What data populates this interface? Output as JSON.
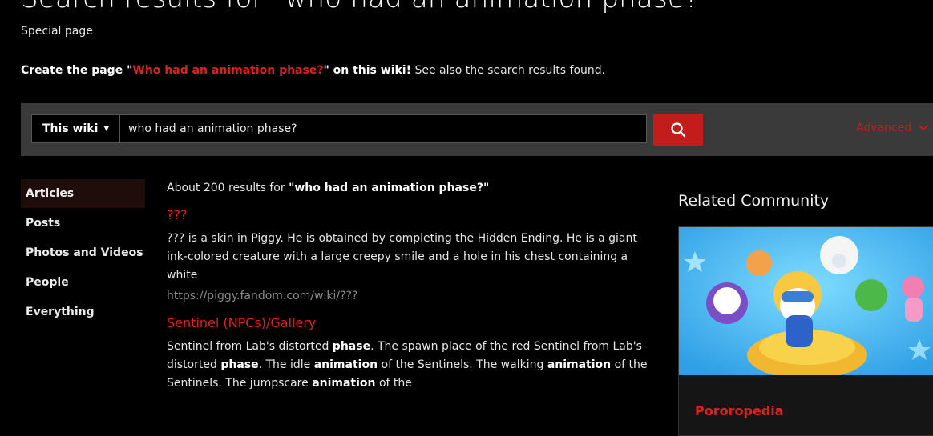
{
  "header": {
    "title": "Search results for \"who had an animation phase?\"",
    "subtitle": "Special page"
  },
  "create_line": {
    "prefix": "Create the page \"",
    "page_name": "Who had an animation phase?",
    "suffix": "\" on this wiki!",
    "see_also": " See also the search results found."
  },
  "search": {
    "scope_label": "This wiki",
    "query": "who had an animation phase?",
    "advanced_label": "Advanced"
  },
  "sidebar": {
    "items": [
      {
        "label": "Articles"
      },
      {
        "label": "Posts"
      },
      {
        "label": "Photos and Videos"
      },
      {
        "label": "People"
      },
      {
        "label": "Everything"
      }
    ]
  },
  "results": {
    "count_prefix": "About 200 results for ",
    "count_query": "\"who had an animation phase?\"",
    "items": [
      {
        "title": "???",
        "snippet": "??? is a skin in Piggy. He is obtained by completing the Hidden Ending. He is a giant ink-colored creature with a large creepy smile and a hole in his chest containing a white",
        "url": "https://piggy.fandom.com/wiki/???"
      },
      {
        "title": "Sentinel (NPCs)/Gallery",
        "snippet_parts": [
          {
            "t": "Sentinel from Lab's distorted "
          },
          {
            "t": "phase",
            "b": true
          },
          {
            "t": ". The spawn place of the red Sentinel from Lab's distorted "
          },
          {
            "t": "phase",
            "b": true
          },
          {
            "t": ". The idle "
          },
          {
            "t": "animation",
            "b": true
          },
          {
            "t": " of the Sentinels. The walking "
          },
          {
            "t": "animation",
            "b": true
          },
          {
            "t": " of the Sentinels. The jumpscare "
          },
          {
            "t": "animation",
            "b": true
          },
          {
            "t": " of the"
          }
        ]
      }
    ]
  },
  "related": {
    "title": "Related Community",
    "community_name": "Pororopedia"
  },
  "colors": {
    "accent_red": "#c31d1b",
    "link_red": "#e0201c",
    "band_gray": "#3a3a3a"
  },
  "icons": {
    "search_button": "search-icon",
    "scope_dropdown": "caret-down-icon",
    "advanced_dropdown": "chevron-down-icon"
  }
}
